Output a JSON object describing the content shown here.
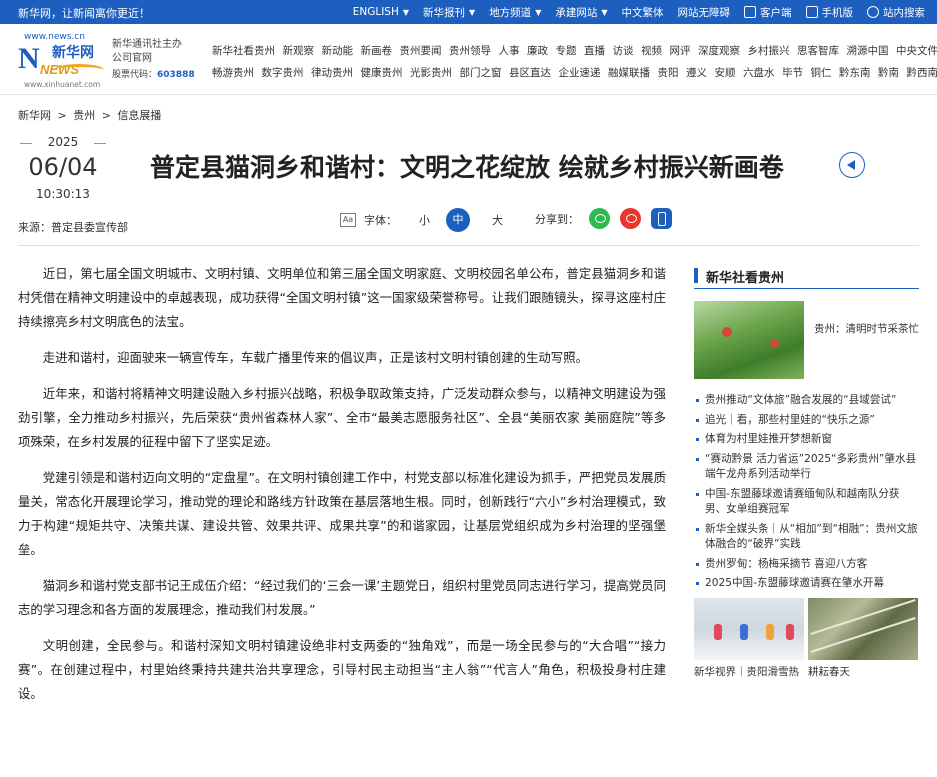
{
  "topbar": {
    "slogan": "新华网，让新闻离你更近！",
    "items": [
      {
        "label": "ENGLISH",
        "dropdown": true
      },
      {
        "label": "新华报刊",
        "dropdown": true
      },
      {
        "label": "地方频道",
        "dropdown": true
      },
      {
        "label": "承建网站",
        "dropdown": true
      },
      {
        "label": "中文繁体",
        "dropdown": false
      },
      {
        "label": "网站无障碍",
        "dropdown": false
      },
      {
        "label": "客户端",
        "icon": "app-icon"
      },
      {
        "label": "手机版",
        "icon": "phone-icon"
      },
      {
        "label": "站内搜索",
        "icon": "search-icon"
      }
    ]
  },
  "logo": {
    "site": "www.news.cn",
    "cn": "新华网",
    "latin": "NEWS",
    "url": "www.xinhuanet.com"
  },
  "agency": {
    "line1": "新华通讯社主办",
    "line2": "公司官网",
    "code_label": "股票代码：",
    "code": "603888"
  },
  "nav_row1": [
    "新华社看贵州",
    "新观察",
    "新动能",
    "新画卷",
    "贵州要闻",
    "贵州领导",
    "人事",
    "廉政",
    "专题",
    "直播",
    "访谈",
    "视频",
    "网评",
    "深度观察",
    "乡村振兴",
    "思客智库",
    "溯源中国",
    "中央文件"
  ],
  "nav_row2": [
    "畅游贵州",
    "数字贵州",
    "律动贵州",
    "健康贵州",
    "光影贵州",
    "部门之窗",
    "县区直达",
    "企业速递",
    "融媒联播",
    "贵阳",
    "遵义",
    "安顺",
    "六盘水",
    "毕节",
    "铜仁",
    "黔东南",
    "黔南",
    "黔西南"
  ],
  "breadcrumb": [
    "新华网",
    ">",
    "贵州",
    ">",
    "信息展播"
  ],
  "date": {
    "year": "2025",
    "md": "06/04",
    "time": "10:30:13"
  },
  "source": "来源：普定县委宣传部",
  "title": "普定县猫洞乡和谐村：文明之花绽放 绘就乡村振兴新画卷",
  "fontbar": {
    "aa": "Aa",
    "label": "字体：",
    "small": "小",
    "mid": "中",
    "large": "大"
  },
  "share": {
    "label": "分享到："
  },
  "article": [
    "近日，第七届全国文明城市、文明村镇、文明单位和第三届全国文明家庭、文明校园名单公布，普定县猫洞乡和谐村凭借在精神文明建设中的卓越表现，成功获得“全国文明村镇”这一国家级荣誉称号。让我们跟随镜头，探寻这座村庄持续擦亮乡村文明底色的法宝。",
    "走进和谐村，迎面驶来一辆宣传车，车载广播里传来的倡议声，正是该村文明村镇创建的生动写照。",
    "近年来，和谐村将精神文明建设融入乡村振兴战略，积极争取政策支持，广泛发动群众参与，以精神文明建设为强劲引擎，全力推动乡村振兴，先后荣获“贵州省森林人家”、全市“最美志愿服务社区”、全县“美丽农家 美丽庭院”等多项殊荣，在乡村发展的征程中留下了坚实足迹。",
    "党建引领是和谐村迈向文明的“定盘星”。在文明村镇创建工作中，村党支部以标准化建设为抓手，严把党员发展质量关，常态化开展理论学习，推动党的理论和路线方针政策在基层落地生根。同时，创新践行“六小”乡村治理模式，致力于构建“规矩共守、决策共谋、建设共管、效果共评、成果共享”的和谐家园，让基层党组织成为乡村治理的坚强堡垒。",
    "猫洞乡和谐村党支部书记王成伍介绍：“经过我们的‘三会一课’主题党日，组织村里党员同志进行学习，提高党员同志的学习理念和各方面的发展理念，推动我们村发展。”",
    "文明创建，全民参与。和谐村深知文明村镇建设绝非村支两委的“独角戏”，而是一场全民参与的“大合唱”“接力赛”。在创建过程中，村里始终秉持共建共治共享理念，引导村民主动担当“主人翁”“代言人”角色，积极投身村庄建设。"
  ],
  "sidebar": {
    "heading": "新华社看贵州",
    "feature_caption": "贵州：清明时节采茶忙",
    "items": [
      "贵州推动“文体旅”融合发展的“县域尝试”",
      "追光｜看，那些村里娃的“快乐之源”",
      "体育为村里娃推开梦想新窗",
      "“赛动黔景 活力省运”2025“多彩贵州”肇水县端午龙舟系列活动举行",
      "中国-东盟藤球邀请赛缅甸队和越南队分获男、女单组赛冠军",
      "新华全媒头条｜从“相加”到“相融”：贵州文旅体融合的“破界”实践",
      "贵州罗甸：杨梅采摘节 喜迎八方客",
      "2025中国-东盟藤球邀请赛在肇水开幕"
    ],
    "thumbs": [
      "新华视界｜贵阳滑雪热",
      "耕耘春天"
    ]
  }
}
